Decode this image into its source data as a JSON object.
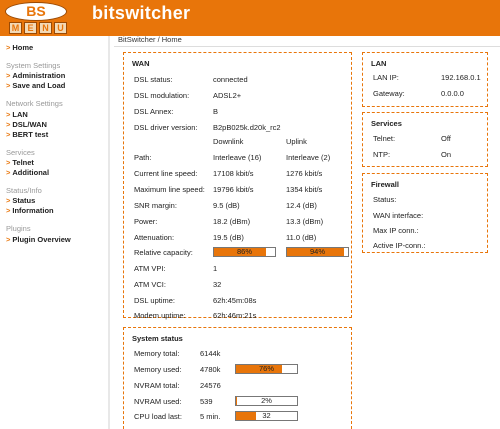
{
  "header": {
    "logo": "BS",
    "logo_menu": [
      "M",
      "E",
      "N",
      "U"
    ],
    "brand": "bitswitcher"
  },
  "nav": {
    "home": "Home",
    "system_settings": "System Settings",
    "administration": "Administration",
    "save_and_load": "Save and Load",
    "network_settings": "Network Settings",
    "lan": "LAN",
    "dsl_wan": "DSL/WAN",
    "bert_test": "BERT test",
    "services": "Services",
    "telnet": "Telnet",
    "additional": "Additional",
    "status_info": "Status/Info",
    "status": "Status",
    "information": "Information",
    "plugins": "Plugins",
    "plugin_overview": "Plugin Overview",
    "arrow": ">"
  },
  "breadcrumb": "BitSwitcher / Home",
  "wan": {
    "title": "WAN",
    "dsl_status_label": "DSL status:",
    "dsl_status": "connected",
    "dsl_modulation_label": "DSL modulation:",
    "dsl_modulation": "ADSL2+",
    "dsl_annex_label": "DSL Annex:",
    "dsl_annex": "B",
    "driver_label": "DSL driver version:",
    "driver": "B2pB025k.d20k_rc2",
    "downlink_header": "Downlink",
    "uplink_header": "Uplink",
    "path_label": "Path:",
    "path_down": "Interleave (16)",
    "path_up": "Interleave (2)",
    "cur_speed_label": "Current line speed:",
    "cur_speed_down": "17108 kbit/s",
    "cur_speed_up": "1276 kbit/s",
    "max_speed_label": "Maximum line speed:",
    "max_speed_down": "19796 kbit/s",
    "max_speed_up": "1354 kbit/s",
    "snr_label": "SNR margin:",
    "snr_down": "9.5 (dB)",
    "snr_up": "12.4 (dB)",
    "power_label": "Power:",
    "power_down": "18.2 (dBm)",
    "power_up": "13.3 (dBm)",
    "atten_label": "Attenuation:",
    "atten_down": "19.5 (dB)",
    "atten_up": "11.0 (dB)",
    "rel_cap_label": "Relative capacity:",
    "rel_cap_down": "86%",
    "rel_cap_up": "94%",
    "rel_cap_down_value": 86,
    "rel_cap_up_value": 94,
    "atm_vpi_label": "ATM VPI:",
    "atm_vpi": "1",
    "atm_vci_label": "ATM VCI:",
    "atm_vci": "32",
    "dsl_uptime_label": "DSL uptime:",
    "dsl_uptime": "62h:45m:08s",
    "modem_uptime_label": "Modem uptime:",
    "modem_uptime": "62h:46m:21s"
  },
  "system": {
    "title": "System status",
    "mem_total_label": "Memory total:",
    "mem_total": "6144k",
    "mem_used_label": "Memory used:",
    "mem_used": "4780k",
    "mem_used_pct": "76%",
    "mem_used_value": 76,
    "nvram_total_label": "NVRAM total:",
    "nvram_total": "24576",
    "nvram_used_label": "NVRAM used:",
    "nvram_used": "539",
    "nvram_used_pct": "2%",
    "nvram_used_value": 2,
    "cpu_label": "CPU load last:",
    "cpu_period": "5 min.",
    "cpu_value_text": "32",
    "cpu_value": 32
  },
  "lan": {
    "title": "LAN",
    "ip_label": "LAN IP:",
    "ip": "192.168.0.1",
    "gw_label": "Gateway:",
    "gw": "0.0.0.0"
  },
  "services": {
    "title": "Services",
    "telnet_label": "Telnet:",
    "telnet": "Off",
    "ntp_label": "NTP:",
    "ntp": "On"
  },
  "firewall": {
    "title": "Firewall",
    "status_label": "Status:",
    "wan_if_label": "WAN interface:",
    "max_ip_label": "Max IP conn.:",
    "active_ip_label": "Active IP-conn.:"
  },
  "colors": {
    "accent": "#e8750a",
    "bar_fill": "#e8750a"
  }
}
